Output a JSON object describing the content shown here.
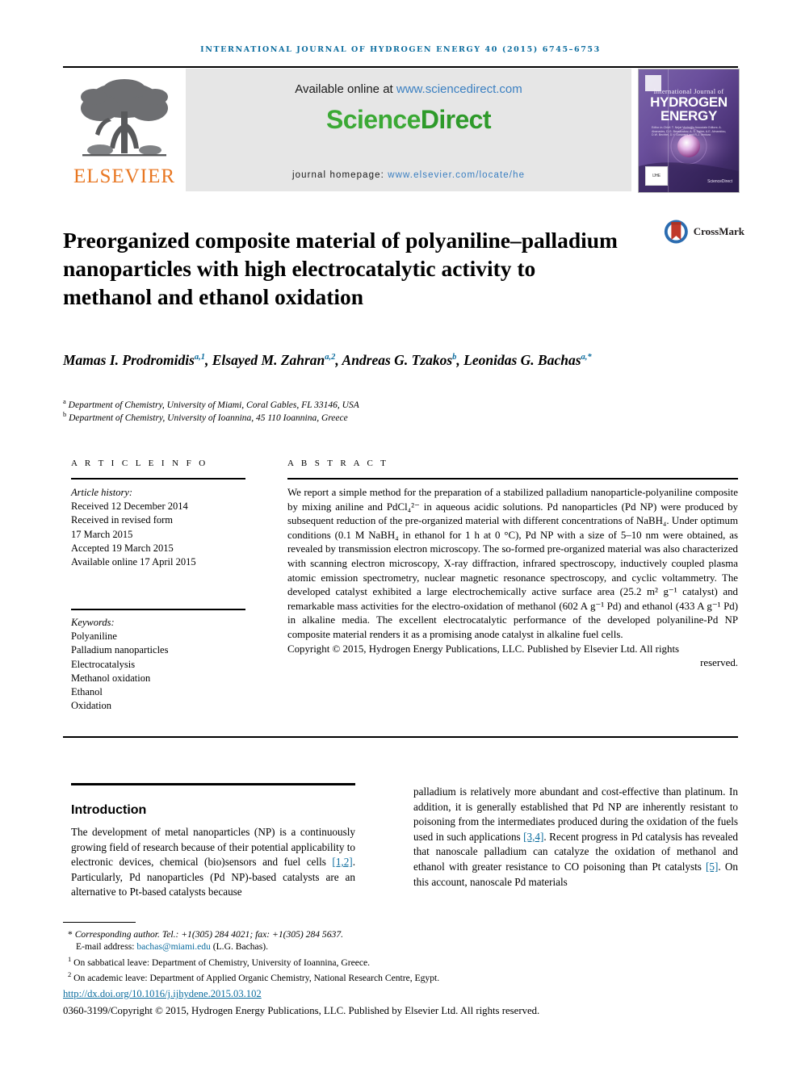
{
  "running_head": "International Journal of Hydrogen Energy 40 (2015) 6745–6753",
  "masthead": {
    "publisher_name": "ELSEVIER",
    "available_prefix": "Available online at ",
    "available_url": "www.sciencedirect.com",
    "brand_science": "Science",
    "brand_direct": "Direct",
    "homepage_label": "journal homepage: ",
    "homepage_url": "www.elsevier.com/locate/he",
    "cover": {
      "line1": "International Journal of",
      "line2": "HYDROGEN",
      "line3": "ENERGY",
      "editors": "Editor-in-Chief:   T. Nejat Veziroğlu\nAssociate Editors:   A. Abanades, D.G. Bessarabov, A. Š. Agüer,\nA.E. Almanidou, D.W. Bechtel,\nD.Y. Goswami and R.J. Ventura",
      "badge": "IJHE",
      "sd_mark": "ScienceDirect"
    }
  },
  "crossmark": {
    "label": "CrossMark"
  },
  "title": "Preorganized composite material of polyaniline–palladium nanoparticles with high electrocatalytic activity to methanol and ethanol oxidation",
  "authors": [
    {
      "name": "Mamas I. Prodromidis",
      "marks": "a,1",
      "sep": ", "
    },
    {
      "name": "Elsayed M. Zahran",
      "marks": "a,2",
      "sep": ", "
    },
    {
      "name": "Andreas G. Tzakos",
      "marks": "b",
      "sep": ", "
    },
    {
      "name": "Leonidas G. Bachas",
      "marks": "a,*",
      "sep": ""
    }
  ],
  "affiliations": [
    {
      "mark": "a",
      "text": "Department of Chemistry, University of Miami, Coral Gables, FL 33146, USA"
    },
    {
      "mark": "b",
      "text": "Department of Chemistry, University of Ioannina, 45 110 Ioannina, Greece"
    }
  ],
  "article_info": {
    "heading": "A R T I C L E   I N F O",
    "history_label": "Article history:",
    "history": [
      "Received 12 December 2014",
      "Received in revised form",
      "17 March 2015",
      "Accepted 19 March 2015",
      "Available online 17 April 2015"
    ],
    "keywords_label": "Keywords:",
    "keywords": [
      "Polyaniline",
      "Palladium nanoparticles",
      "Electrocatalysis",
      "Methanol oxidation",
      "Ethanol",
      "Oxidation"
    ]
  },
  "abstract": {
    "heading": "A B S T R A C T",
    "body": "We report a simple method for the preparation of a stabilized palladium nanoparticle-polyaniline composite by mixing aniline and PdCl₄²⁻ in aqueous acidic solutions. Pd nanoparticles (Pd NP) were produced by subsequent reduction of the pre-organized material with different concentrations of NaBH₄. Under optimum conditions (0.1 M NaBH₄ in ethanol for 1 h at 0 °C), Pd NP with a size of 5–10 nm were obtained, as revealed by transmission electron microscopy. The so-formed pre-organized material was also characterized with scanning electron microscopy, X-ray diffraction, infrared spectroscopy, inductively coupled plasma atomic emission spectrometry, nuclear magnetic resonance spectroscopy, and cyclic voltammetry. The developed catalyst exhibited a large electrochemically active surface area (25.2 m² g⁻¹ catalyst) and remarkable mass activities for the electro-oxidation of methanol (602 A g⁻¹ Pd) and ethanol (433 A g⁻¹ Pd) in alkaline media. The excellent electrocatalytic performance of the developed polyaniline-Pd NP composite material renders it as a promising anode catalyst in alkaline fuel cells.",
    "copyright_main": "Copyright © 2015, Hydrogen Energy Publications, LLC. Published by Elsevier Ltd. All rights",
    "copyright_last": "reserved."
  },
  "section": {
    "title": "Introduction",
    "left_paragraph_a": "The development of metal nanoparticles (NP) is a continuously growing field of research because of their potential applicability to electronic devices, chemical (bio)sensors and fuel cells ",
    "left_ref1": "[1,2]",
    "left_paragraph_b": ". Particularly, Pd nanoparticles (Pd NP)-based catalysts are an alternative to Pt-based catalysts because",
    "right_paragraph_a": "palladium is relatively more abundant and cost-effective than platinum. In addition, it is generally established that Pd NP are inherently resistant to poisoning from the intermediates produced during the oxidation of the fuels used in such applications ",
    "right_ref1": "[3,4]",
    "right_paragraph_b": ". Recent progress in Pd catalysis has revealed that nanoscale palladium can catalyze the oxidation of methanol and ethanol with greater resistance to CO poisoning than Pt catalysts ",
    "right_ref2": "[5]",
    "right_paragraph_c": ". On this account, nanoscale Pd materials"
  },
  "footer": {
    "corresponding": "Corresponding author. Tel.: +1(305) 284 4021; fax: +1(305) 284 5637.",
    "email_label": "E-mail address: ",
    "email": "bachas@miami.edu",
    "email_suffix": " (L.G. Bachas).",
    "note1_mark": "1",
    "note1": "On sabbatical leave: Department of Chemistry, University of Ioannina, Greece.",
    "note2_mark": "2",
    "note2": "On academic leave: Department of Applied Organic Chemistry, National Research Centre, Egypt.",
    "doi": "http://dx.doi.org/10.1016/j.ijhydene.2015.03.102",
    "issn_line": "0360-3199/Copyright © 2015, Hydrogen Energy Publications, LLC. Published by Elsevier Ltd. All rights reserved."
  },
  "colors": {
    "link_blue": "#0b6c9e",
    "sciencedirect_green": "#3ba935",
    "elsevier_orange": "#e87722",
    "band_gray": "#e6e6e6"
  }
}
